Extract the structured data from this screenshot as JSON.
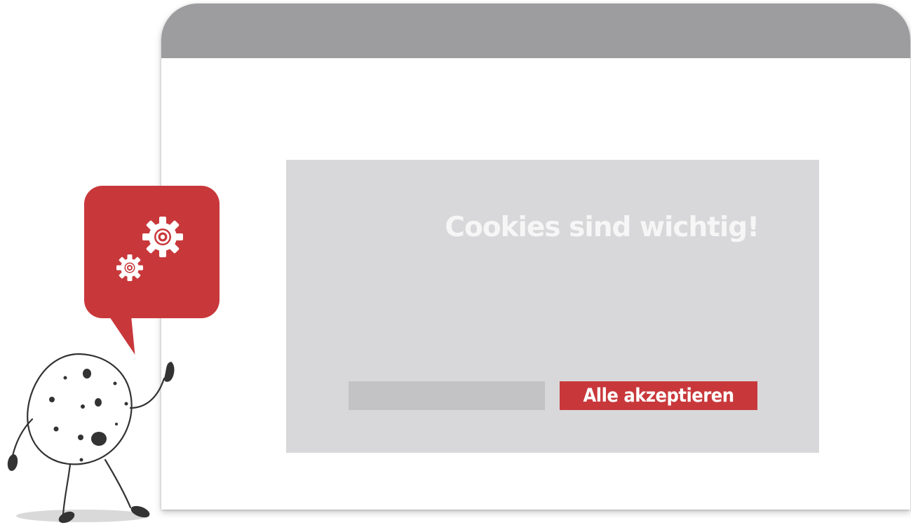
{
  "cookie_banner": {
    "title": "Cookies sind wichtig!",
    "accept_label": "Alle akzeptieren"
  },
  "colors": {
    "accent": "#c8383b",
    "title_bar": "#9d9d9f",
    "banner_background": "#d8d8da",
    "placeholder_button": "#c3c3c5"
  },
  "icons": {
    "bubble": "gears-icon",
    "mascot": "cookie-mascot"
  }
}
